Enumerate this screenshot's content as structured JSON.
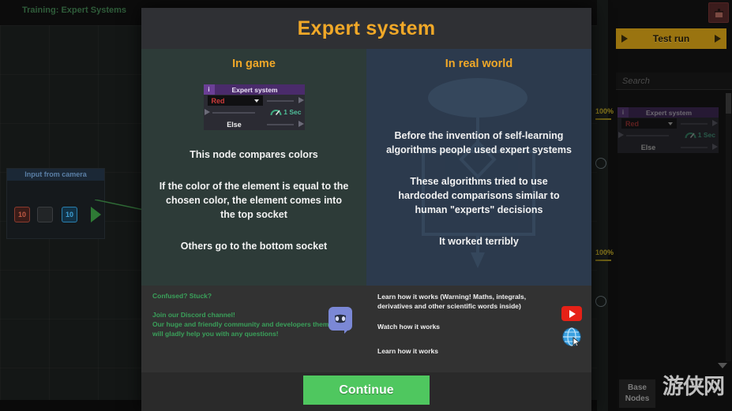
{
  "modal": {
    "title": "Expert system",
    "continue_label": "Continue",
    "left": {
      "heading": "In game",
      "paragraphs": [
        "This node compares colors",
        "If the color of the element is equal to the chosen color, the element comes into the top socket",
        "Others go to the bottom socket"
      ],
      "node": {
        "info_glyph": "i",
        "title": "Expert system",
        "selected_color": "Red",
        "else_label": "Else",
        "timer_label": "1 Sec"
      }
    },
    "right": {
      "heading": "In real world",
      "paragraphs": [
        "Before the invention of self-learning algorithms people used expert systems",
        "These algorithms tried to use hardcoded comparisons similar to human \"experts\" decisions",
        "It worked terribly"
      ]
    },
    "footer_left": {
      "headline": "Confused? Stuck?",
      "lines": [
        "Join our Discord channel!",
        "Our huge and friendly community and developers themselves",
        "will gladly help you with any questions!"
      ],
      "icon": "discord-icon"
    },
    "footer_right": {
      "lines": [
        "Learn how it works (Warning! Maths, integrals,",
        "derivatives and other scientific words inside)"
      ],
      "watch_label": "Watch how it works",
      "learn_label": "Learn how it works",
      "youtube_icon": "youtube-icon",
      "web_icon": "globe-icon"
    }
  },
  "game": {
    "training_title": "Training: Expert Systems",
    "camera_node": {
      "title": "Input from camera",
      "slot_red": "10",
      "slot_empty": "",
      "slot_blue": "10"
    },
    "sidebar": {
      "test_run_label": "Test run",
      "search_placeholder": "Search",
      "base_nodes_label_line1": "Base",
      "base_nodes_label_line2": "Nodes",
      "palette_node": {
        "info_glyph": "i",
        "title": "Expert system",
        "selected_color": "Red",
        "else_label": "Else",
        "timer_label": "1 Sec"
      },
      "meters": [
        "100%",
        "100%"
      ]
    },
    "watermark": "游侠网"
  },
  "colors": {
    "accent_orange": "#f0a828",
    "continue_green": "#4fc75f",
    "discord_blue": "#7b88d6",
    "youtube_red": "#e62117",
    "node_purple": "#4a2b6b",
    "red_value": "#cf3a3a",
    "teal_timer": "#4fbf9a",
    "test_run_gold": "#9a7410"
  }
}
